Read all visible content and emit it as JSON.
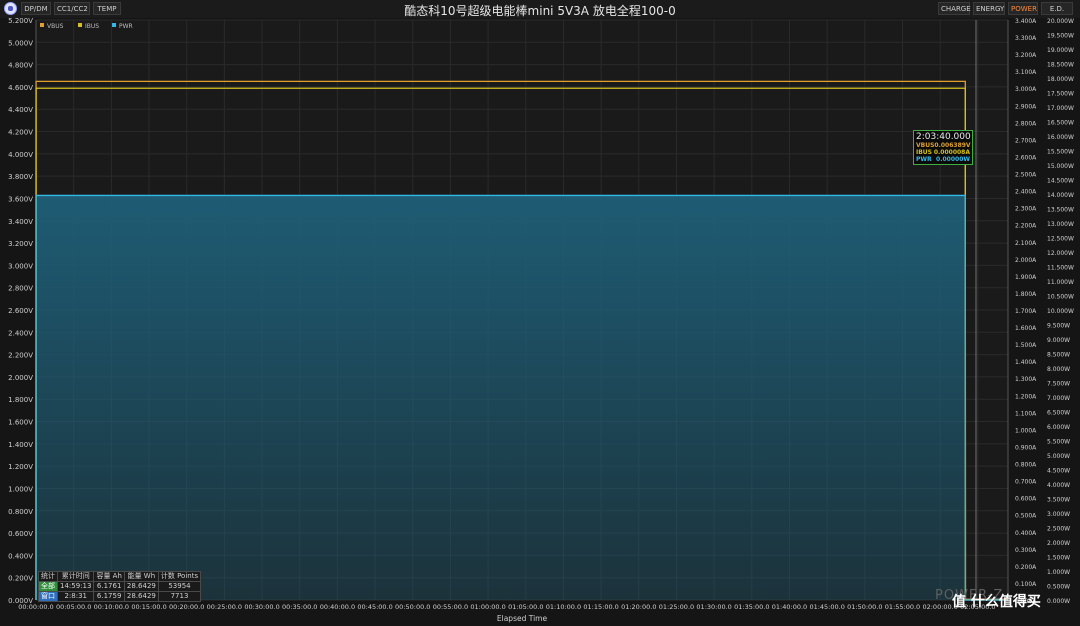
{
  "window": {
    "title": "酷态科10号超级电能棒mini 5V3A 放电全程100-0",
    "left_tabs": [
      "DP/DM",
      "CC1/CC2",
      "TEMP"
    ],
    "right_tabs": [
      "CHARGE",
      "ENERGY",
      "POWER",
      "E.D."
    ],
    "active_tab": "POWER"
  },
  "colors": {
    "background": "#151515",
    "vbus": "#e0a030",
    "ibus": "#d4c020",
    "pwr": "#33b8e8",
    "fill": "#1e5f78"
  },
  "stats": {
    "headers": [
      "统计",
      "累计时间",
      "容量 Ah",
      "能量 Wh",
      "计数 Points"
    ],
    "rows": [
      [
        "全部",
        "14:59:13",
        "6.1761",
        "28.6429",
        "53954"
      ],
      [
        "窗口",
        "2:8:31",
        "6.1759",
        "28.6429",
        "7713"
      ]
    ]
  },
  "tooltip": {
    "time": "2:03:40.000",
    "rows": [
      {
        "label": "VBUS",
        "value": "0.006389V",
        "color": "#e0a030"
      },
      {
        "label": "IBUS",
        "value": "0.000008A",
        "color": "#d4c020"
      },
      {
        "label": "PWR",
        "value": "0.00000W",
        "color": "#33b8e8"
      }
    ]
  },
  "watermark": "POWER-Z",
  "credit": "值 什么值得买",
  "chart_data": {
    "type": "line",
    "xlabel": "Elapsed Time",
    "x_range_seconds": [
      0,
      7740
    ],
    "x_ticks": [
      "00:00:00.0",
      "00:05:00.0",
      "00:10:00.0",
      "00:15:00.0",
      "00:20:00.0",
      "00:25:00.0",
      "00:30:00.0",
      "00:35:00.0",
      "00:40:00.0",
      "00:45:00.0",
      "00:50:00.0",
      "00:55:00.0",
      "01:00:00.0",
      "01:05:00.0",
      "01:10:00.0",
      "01:15:00.0",
      "01:20:00.0",
      "01:25:00.0",
      "01:30:00.0",
      "01:35:00.0",
      "01:40:00.0",
      "01:45:00.0",
      "01:50:00.0",
      "01:55:00.0",
      "02:00:00.0",
      "02:05:00.0"
    ],
    "y_left": {
      "unit": "V",
      "range": [
        0,
        5.2
      ],
      "ticks": [
        "0.000V",
        "0.200V",
        "0.400V",
        "0.600V",
        "0.800V",
        "1.000V",
        "1.200V",
        "1.400V",
        "1.600V",
        "1.800V",
        "2.000V",
        "2.200V",
        "2.400V",
        "2.600V",
        "2.800V",
        "3.000V",
        "3.200V",
        "3.400V",
        "3.600V",
        "3.800V",
        "4.000V",
        "4.200V",
        "4.400V",
        "4.600V",
        "4.800V",
        "5.000V",
        "5.200V"
      ]
    },
    "y_mid": {
      "unit": "A",
      "range": [
        0,
        3.4
      ],
      "ticks": [
        "0.000A",
        "0.100A",
        "0.200A",
        "0.300A",
        "0.400A",
        "0.500A",
        "0.600A",
        "0.700A",
        "0.800A",
        "0.900A",
        "1.000A",
        "1.100A",
        "1.200A",
        "1.300A",
        "1.400A",
        "1.500A",
        "1.600A",
        "1.700A",
        "1.800A",
        "1.900A",
        "2.000A",
        "2.100A",
        "2.200A",
        "2.300A",
        "2.400A",
        "2.500A",
        "2.600A",
        "2.700A",
        "2.800A",
        "2.900A",
        "3.000A",
        "3.100A",
        "3.200A",
        "3.300A",
        "3.400A"
      ]
    },
    "y_right": {
      "unit": "W",
      "range": [
        0,
        20
      ],
      "ticks": [
        "0.000W",
        "0.500W",
        "1.000W",
        "1.500W",
        "2.000W",
        "2.500W",
        "3.000W",
        "3.500W",
        "4.000W",
        "4.500W",
        "5.000W",
        "5.500W",
        "6.000W",
        "6.500W",
        "7.000W",
        "7.500W",
        "8.000W",
        "8.500W",
        "9.000W",
        "9.500W",
        "10.000W",
        "10.500W",
        "11.000W",
        "11.500W",
        "12.000W",
        "12.500W",
        "13.000W",
        "13.500W",
        "14.000W",
        "14.500W",
        "15.000W",
        "15.500W",
        "16.000W",
        "16.500W",
        "17.000W",
        "17.500W",
        "18.000W",
        "18.500W",
        "19.000W",
        "19.500W",
        "20.000W"
      ]
    },
    "series": [
      {
        "name": "VBUS",
        "axis": "left",
        "x": [
          0,
          0.5,
          7400,
          7401,
          7740
        ],
        "y": [
          0,
          4.65,
          4.65,
          0.006,
          0.006
        ]
      },
      {
        "name": "IBUS",
        "axis": "mid",
        "x": [
          0,
          0.5,
          7400,
          7401,
          7740
        ],
        "y": [
          0,
          3.0,
          3.0,
          0.0,
          0.0
        ]
      },
      {
        "name": "PWR",
        "axis": "right",
        "x": [
          0,
          0.5,
          7400,
          7401,
          7740
        ],
        "y": [
          0,
          13.95,
          13.95,
          0.0,
          0.0
        ]
      }
    ],
    "grid": true,
    "legend": "top-left"
  }
}
